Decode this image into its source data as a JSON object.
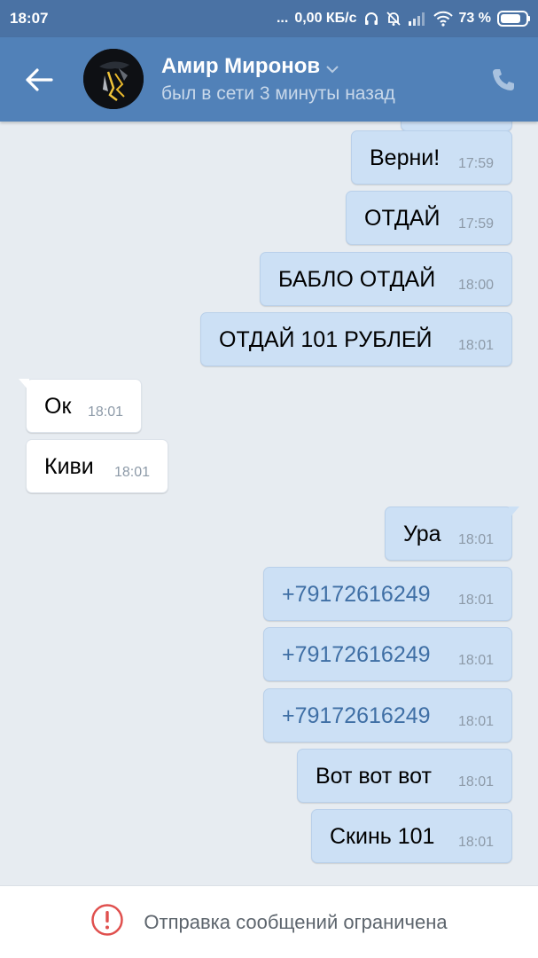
{
  "status_bar": {
    "time": "18:07",
    "dots": "...",
    "net_speed": "0,00 КБ/с",
    "battery": "73 %"
  },
  "header": {
    "name": "Амир Миронов",
    "status": "был в сети 3 минуты назад"
  },
  "messages": [
    {
      "dir": "out",
      "text": "Верни!",
      "time": "17:59"
    },
    {
      "dir": "out",
      "text": "ОТДАЙ",
      "time": "17:59"
    },
    {
      "dir": "out",
      "text": "БАБЛО ОТДАЙ",
      "time": "18:00"
    },
    {
      "dir": "out",
      "text": "ОТДАЙ 101 РУБЛЕЙ",
      "time": "18:01"
    },
    {
      "dir": "in",
      "text": "Ок",
      "time": "18:01"
    },
    {
      "dir": "in",
      "text": "Киви",
      "time": "18:01"
    },
    {
      "dir": "out",
      "text": "Ура",
      "time": "18:01"
    },
    {
      "dir": "out",
      "text": "+79172616249",
      "time": "18:01",
      "link": true
    },
    {
      "dir": "out",
      "text": "+79172616249",
      "time": "18:01",
      "link": true
    },
    {
      "dir": "out",
      "text": "+79172616249",
      "time": "18:01",
      "link": true
    },
    {
      "dir": "out",
      "text": "Вот вот вот",
      "time": "18:01"
    },
    {
      "dir": "out",
      "text": "Скинь 101",
      "time": "18:01"
    }
  ],
  "footer": {
    "restriction_text": "Отправка сообщений ограничена"
  },
  "colors": {
    "status_bar": "#4a72a4",
    "app_bar": "#5181b8",
    "background": "#e7ecf1",
    "outgoing_bubble": "#cce0f5",
    "incoming_bubble": "#ffffff",
    "link": "#3f6fa5",
    "alert": "#e0504e"
  },
  "icons": [
    "back-arrow-icon",
    "phone-icon",
    "chevron-down-icon",
    "alert-icon",
    "headphones-icon",
    "bell-off-icon",
    "signal-icon",
    "wifi-icon",
    "battery-icon"
  ]
}
